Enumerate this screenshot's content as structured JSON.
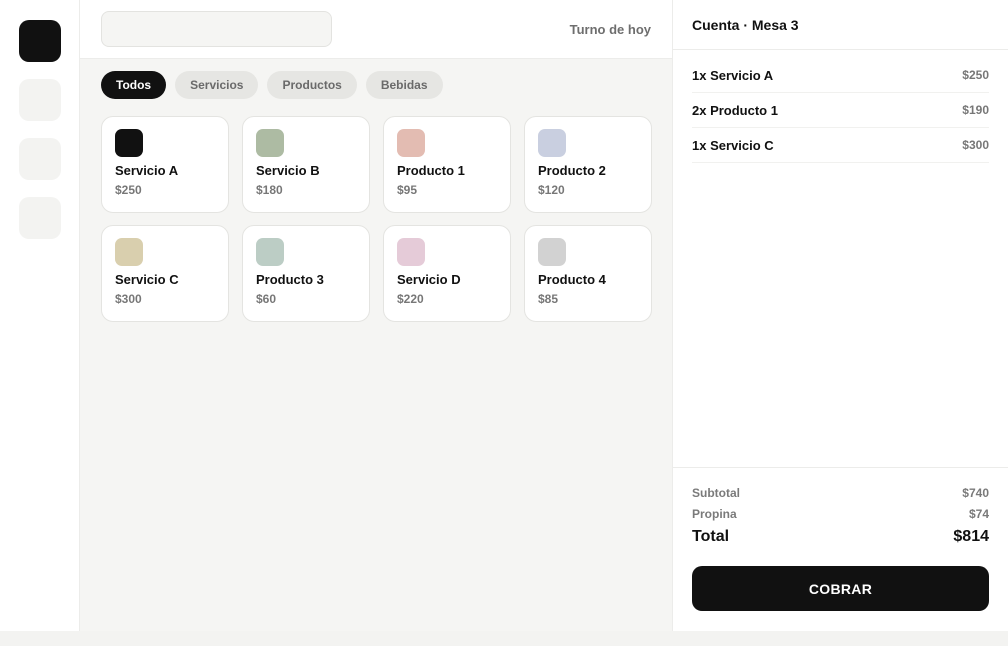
{
  "rail": {
    "items": [
      {
        "name": "rail-item-1",
        "active": true
      },
      {
        "name": "rail-item-2",
        "active": false
      },
      {
        "name": "rail-item-3",
        "active": false
      },
      {
        "name": "rail-item-4",
        "active": false
      }
    ]
  },
  "topbar": {
    "search_value": "",
    "search_placeholder": "",
    "shift_label": "Turno de hoy"
  },
  "filters": [
    {
      "label": "Todos",
      "active": true
    },
    {
      "label": "Servicios",
      "active": false
    },
    {
      "label": "Productos",
      "active": false
    },
    {
      "label": "Bebidas",
      "active": false
    }
  ],
  "catalog": [
    {
      "name": "Servicio A",
      "price": "$250",
      "color": "#111111"
    },
    {
      "name": "Servicio B",
      "price": "$180",
      "color": "#adbba3"
    },
    {
      "name": "Producto 1",
      "price": "$95",
      "color": "#e3bcb2"
    },
    {
      "name": "Producto 2",
      "price": "$120",
      "color": "#c9cfe0"
    },
    {
      "name": "Servicio C",
      "price": "$300",
      "color": "#d9cfae"
    },
    {
      "name": "Producto 3",
      "price": "$60",
      "color": "#bccdc5"
    },
    {
      "name": "Servicio D",
      "price": "$220",
      "color": "#e5cbd8"
    },
    {
      "name": "Producto 4",
      "price": "$85",
      "color": "#d2d2d2"
    }
  ],
  "order": {
    "title": "Cuenta · Mesa 3",
    "items": [
      {
        "label": "1x Servicio A",
        "price": "$250"
      },
      {
        "label": "2x Producto 1",
        "price": "$190"
      },
      {
        "label": "1x Servicio C",
        "price": "$300"
      }
    ],
    "subtotal_label": "Subtotal",
    "subtotal": "$740",
    "tip_label": "Propina",
    "tip": "$74",
    "total_label": "Total",
    "total": "$814",
    "charge_label": "COBRAR"
  }
}
